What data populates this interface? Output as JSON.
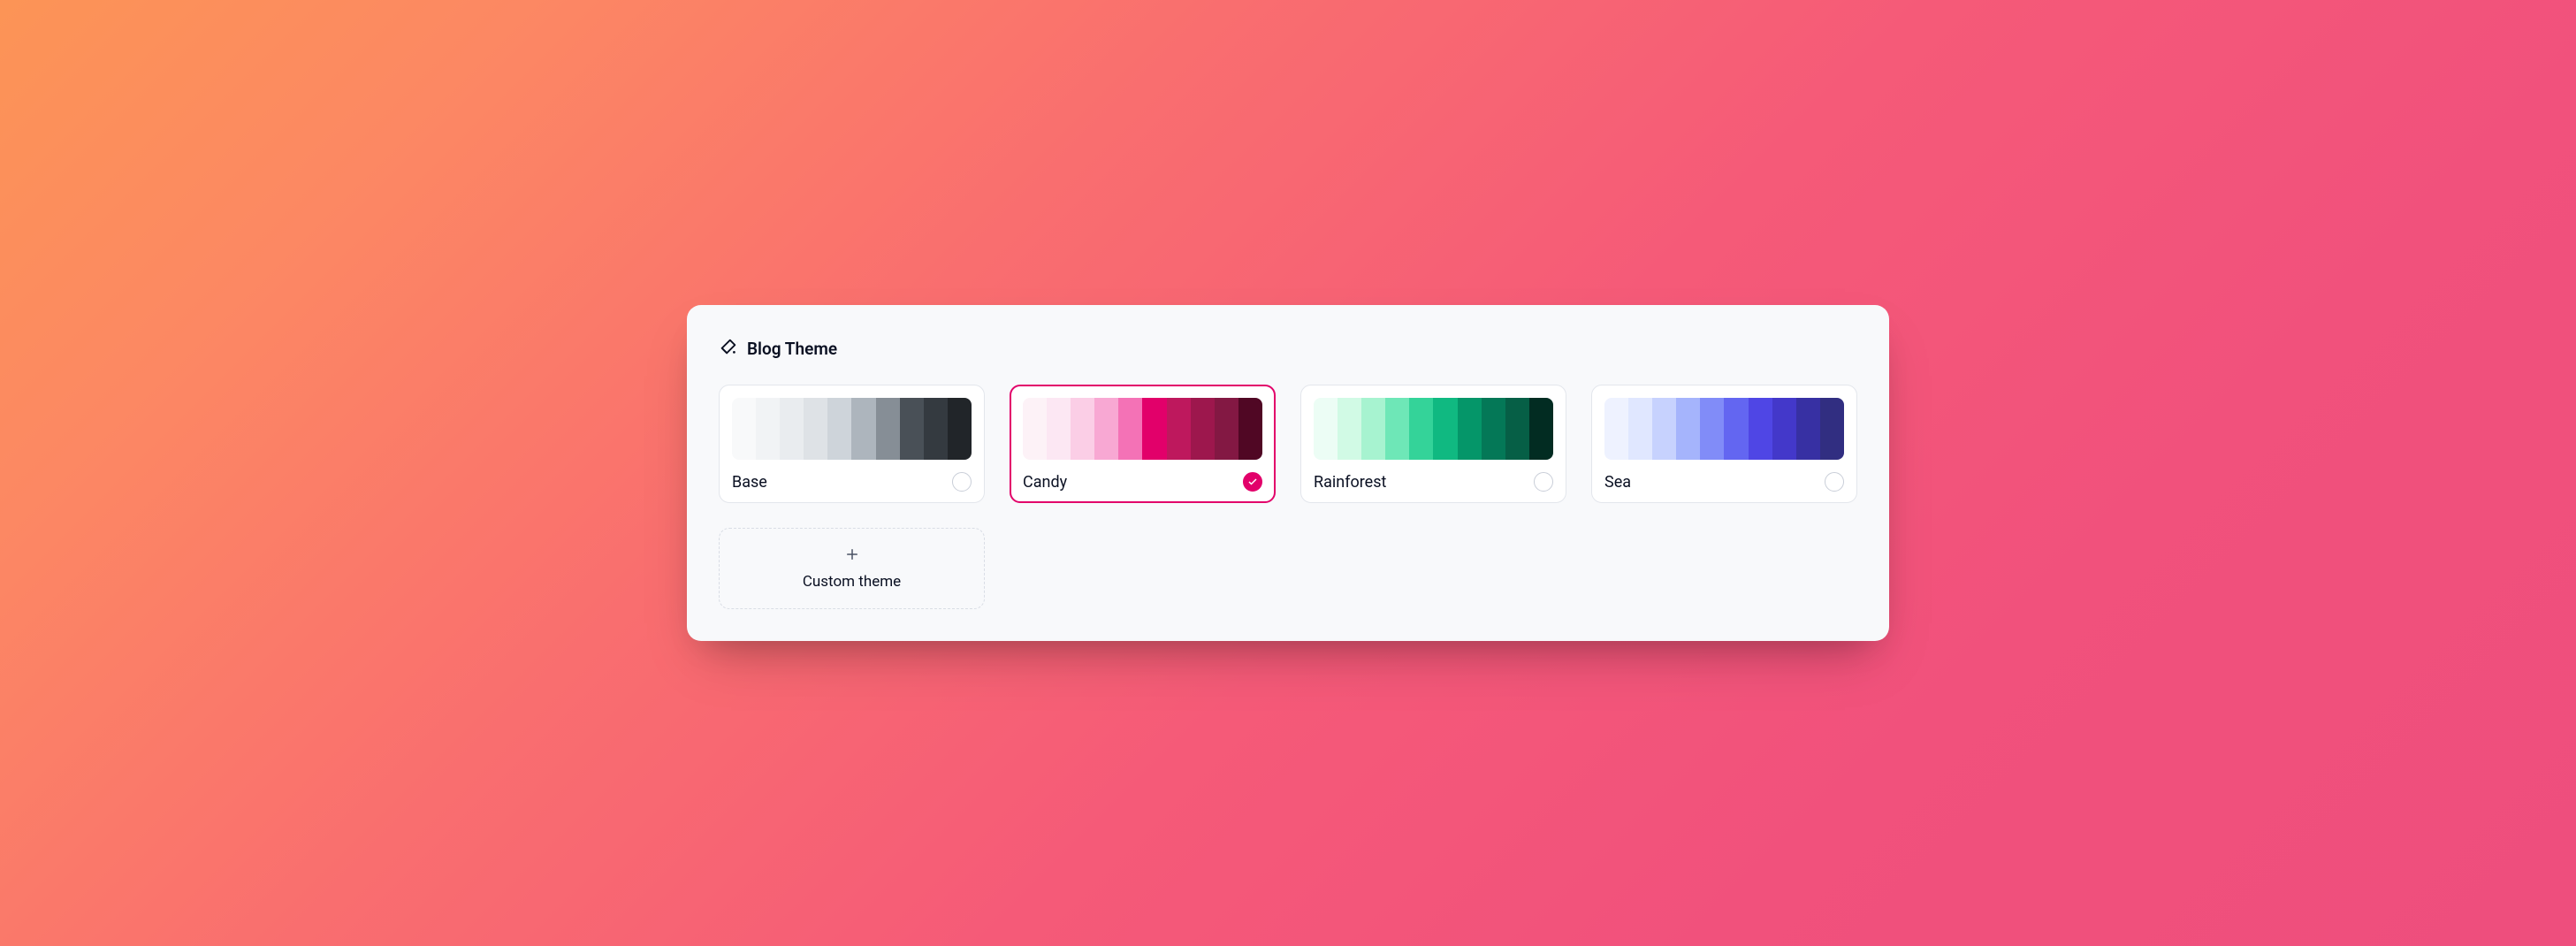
{
  "panel": {
    "title": "Blog Theme"
  },
  "themes": [
    {
      "label": "Base",
      "selected": false,
      "swatches": [
        "#f8f9fa",
        "#f1f3f5",
        "#e9ecef",
        "#dee2e6",
        "#ced4da",
        "#adb5bd",
        "#868e96",
        "#495057",
        "#343a40",
        "#212529"
      ]
    },
    {
      "label": "Candy",
      "selected": true,
      "swatches": [
        "#fdf2f7",
        "#fce7f3",
        "#fbcee6",
        "#f8a8d3",
        "#f472b6",
        "#e2006a",
        "#be185d",
        "#9d174d",
        "#831843",
        "#500724"
      ]
    },
    {
      "label": "Rainforest",
      "selected": false,
      "swatches": [
        "#ecfdf5",
        "#d1fae5",
        "#a7f3d0",
        "#6ee7b7",
        "#34d399",
        "#10b981",
        "#059669",
        "#047857",
        "#065f46",
        "#022c22"
      ]
    },
    {
      "label": "Sea",
      "selected": false,
      "swatches": [
        "#eef2ff",
        "#e0e7ff",
        "#c7d2fe",
        "#a5b4fc",
        "#818cf8",
        "#6366f1",
        "#4f46e5",
        "#4338ca",
        "#3730a3",
        "#312e81"
      ]
    }
  ],
  "custom": {
    "label": "Custom theme"
  }
}
